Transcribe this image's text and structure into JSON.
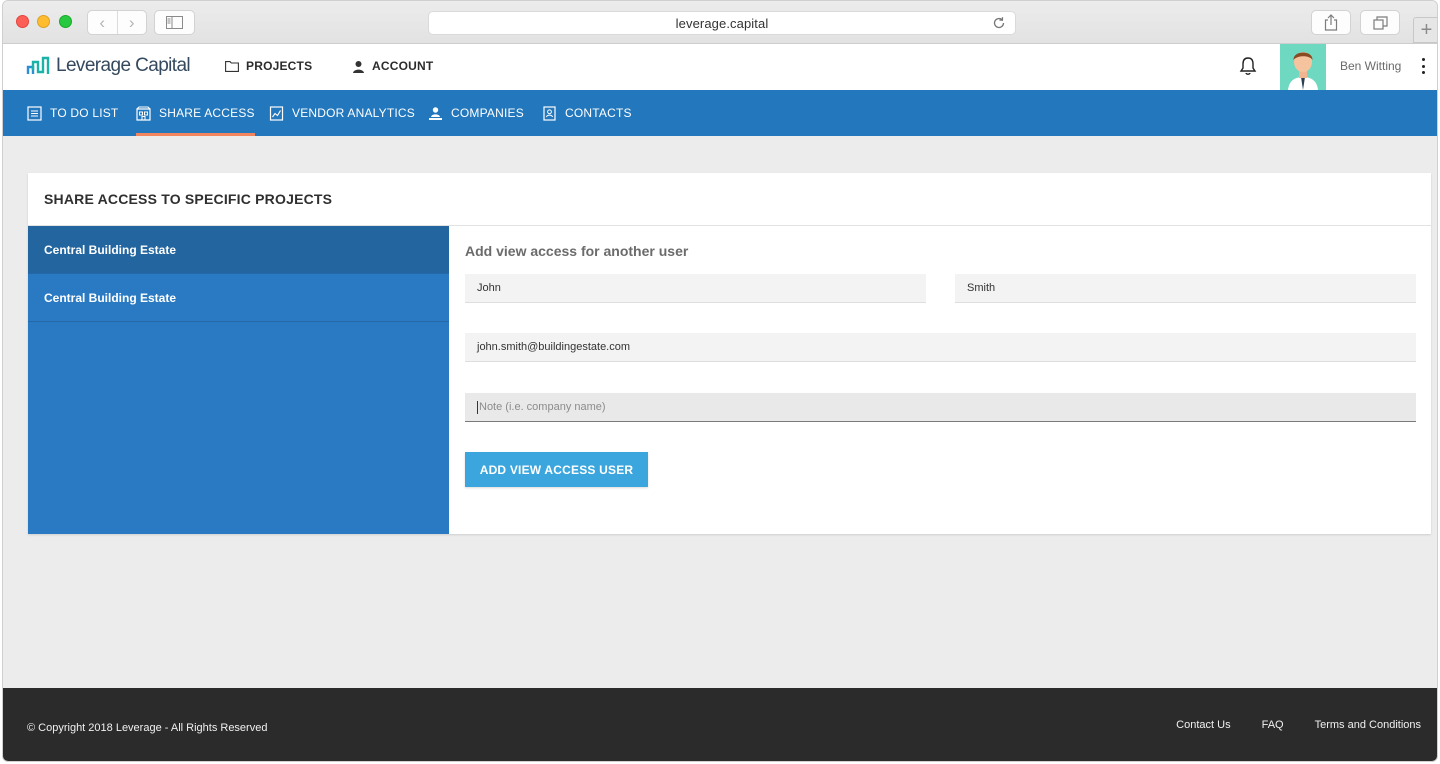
{
  "browser": {
    "url": "leverage.capital",
    "back_glyph": "‹",
    "forward_glyph": "›",
    "new_tab_glyph": "+"
  },
  "header": {
    "logo_text": "Leverage Capital",
    "nav": [
      {
        "label": "PROJECTS",
        "icon": "folder-icon"
      },
      {
        "label": "ACCOUNT",
        "icon": "user-icon"
      }
    ],
    "user": {
      "name": "Ben Witting"
    }
  },
  "subnav": {
    "items": [
      {
        "label": "TO DO LIST",
        "icon": "list-icon",
        "active": false
      },
      {
        "label": "SHARE ACCESS",
        "icon": "share-access-icon",
        "active": true
      },
      {
        "label": "VENDOR ANALYTICS",
        "icon": "analytics-icon",
        "active": false
      },
      {
        "label": "COMPANIES",
        "icon": "companies-icon",
        "active": false
      },
      {
        "label": "CONTACTS",
        "icon": "contacts-icon",
        "active": false
      }
    ]
  },
  "main": {
    "title": "SHARE ACCESS TO SPECIFIC PROJECTS",
    "projects": [
      {
        "name": "Central Building Estate",
        "selected": true
      },
      {
        "name": "Central Building Estate",
        "selected": false
      }
    ],
    "form": {
      "heading": "Add view access for another user",
      "first_name": "John",
      "last_name": "Smith",
      "email": "john.smith@buildingestate.com",
      "note_placeholder": "Note (i.e. company name)",
      "submit_label": "ADD VIEW ACCESS USER"
    }
  },
  "footer": {
    "copyright": "© Copyright 2018 Leverage - All Rights Reserved",
    "links": [
      "Contact Us",
      "FAQ",
      "Terms and Conditions"
    ]
  },
  "colors": {
    "nav_blue": "#2277bd",
    "active_underline": "#f2855d",
    "project_panel": "#2a7ac3",
    "button": "#3aa6dd",
    "footer": "#2b2b2b"
  }
}
